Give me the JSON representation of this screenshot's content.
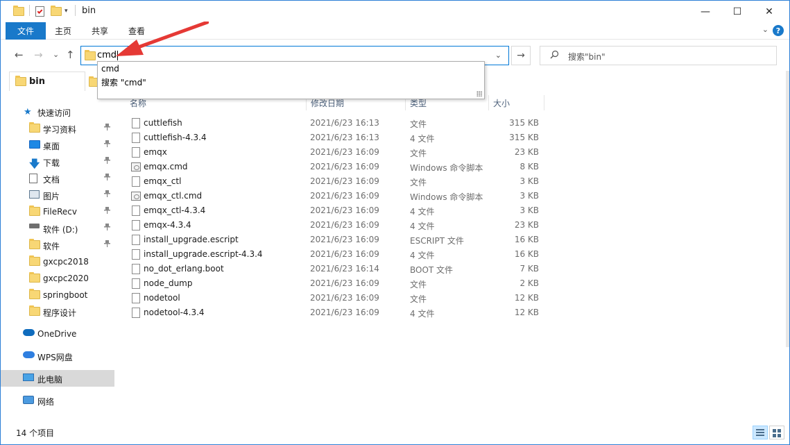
{
  "window": {
    "title": "bin",
    "minimize_glyph": "—",
    "maximize_glyph": "☐",
    "close_glyph": "✕"
  },
  "ribbon": {
    "tabs": [
      "文件",
      "主页",
      "共享",
      "查看"
    ],
    "help_glyph": "?",
    "expand_glyph": "⌄"
  },
  "nav": {
    "back_glyph": "←",
    "forward_glyph": "→",
    "recent_glyph": "⌄",
    "up_glyph": "↑",
    "refresh_glyph": "→"
  },
  "address": {
    "value": "cmd",
    "dropdown_glyph": "⌄"
  },
  "suggestions": [
    "cmd",
    "搜索 \"cmd\""
  ],
  "search": {
    "icon_glyph": "⌕",
    "placeholder": "搜索\"bin\""
  },
  "sidebar": {
    "tab_label": "bin",
    "quick_access": {
      "label": "快速访问",
      "items": [
        {
          "label": "学习资料",
          "icon": "folder-icon",
          "pinned": true
        },
        {
          "label": "桌面",
          "icon": "desktop-icon",
          "pinned": true
        },
        {
          "label": "下载",
          "icon": "download-icon",
          "pinned": true
        },
        {
          "label": "文档",
          "icon": "document-icon",
          "pinned": true
        },
        {
          "label": "图片",
          "icon": "picture-icon",
          "pinned": true
        },
        {
          "label": "FileRecv",
          "icon": "folder-icon",
          "pinned": true
        },
        {
          "label": "软件 (D:)",
          "icon": "drive-icon",
          "pinned": true
        },
        {
          "label": "软件",
          "icon": "folder-icon",
          "pinned": true
        },
        {
          "label": "gxcpc2018",
          "icon": "folder-icon",
          "pinned": false
        },
        {
          "label": "gxcpc2020",
          "icon": "folder-icon",
          "pinned": false
        },
        {
          "label": "springboot",
          "icon": "folder-icon",
          "pinned": false
        },
        {
          "label": "程序设计",
          "icon": "folder-icon",
          "pinned": false
        }
      ]
    },
    "onedrive": "OneDrive",
    "wps": "WPS网盘",
    "this_pc": "此电脑",
    "network": "网络",
    "pin_glyph": "📌"
  },
  "columns": {
    "name": "名称",
    "date": "修改日期",
    "type": "类型",
    "size": "大小"
  },
  "files": [
    {
      "name": "cuttlefish",
      "date": "2021/6/23 16:13",
      "type": "文件",
      "size": "315 KB",
      "icon": "file"
    },
    {
      "name": "cuttlefish-4.3.4",
      "date": "2021/6/23 16:13",
      "type": "4 文件",
      "size": "315 KB",
      "icon": "file"
    },
    {
      "name": "emqx",
      "date": "2021/6/23 16:09",
      "type": "文件",
      "size": "23 KB",
      "icon": "file"
    },
    {
      "name": "emqx.cmd",
      "date": "2021/6/23 16:09",
      "type": "Windows 命令脚本",
      "size": "8 KB",
      "icon": "cmd"
    },
    {
      "name": "emqx_ctl",
      "date": "2021/6/23 16:09",
      "type": "文件",
      "size": "3 KB",
      "icon": "file"
    },
    {
      "name": "emqx_ctl.cmd",
      "date": "2021/6/23 16:09",
      "type": "Windows 命令脚本",
      "size": "3 KB",
      "icon": "cmd"
    },
    {
      "name": "emqx_ctl-4.3.4",
      "date": "2021/6/23 16:09",
      "type": "4 文件",
      "size": "3 KB",
      "icon": "file"
    },
    {
      "name": "emqx-4.3.4",
      "date": "2021/6/23 16:09",
      "type": "4 文件",
      "size": "23 KB",
      "icon": "file"
    },
    {
      "name": "install_upgrade.escript",
      "date": "2021/6/23 16:09",
      "type": "ESCRIPT 文件",
      "size": "16 KB",
      "icon": "file"
    },
    {
      "name": "install_upgrade.escript-4.3.4",
      "date": "2021/6/23 16:09",
      "type": "4 文件",
      "size": "16 KB",
      "icon": "file"
    },
    {
      "name": "no_dot_erlang.boot",
      "date": "2021/6/23 16:14",
      "type": "BOOT 文件",
      "size": "7 KB",
      "icon": "file"
    },
    {
      "name": "node_dump",
      "date": "2021/6/23 16:09",
      "type": "文件",
      "size": "2 KB",
      "icon": "file"
    },
    {
      "name": "nodetool",
      "date": "2021/6/23 16:09",
      "type": "文件",
      "size": "12 KB",
      "icon": "file"
    },
    {
      "name": "nodetool-4.3.4",
      "date": "2021/6/23 16:09",
      "type": "4 文件",
      "size": "12 KB",
      "icon": "file"
    }
  ],
  "status": {
    "item_count": "14 个项目"
  },
  "colors": {
    "accent": "#1979ca",
    "annotation": "#e53935"
  }
}
